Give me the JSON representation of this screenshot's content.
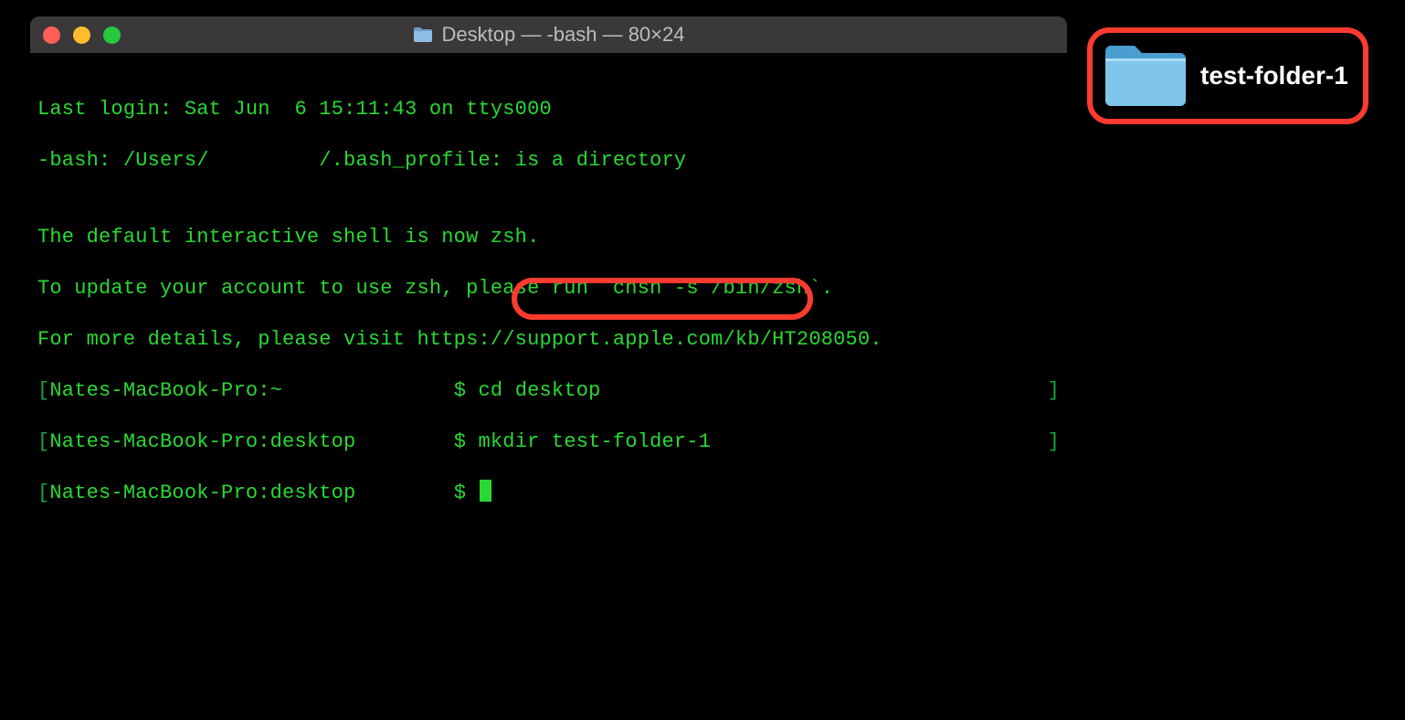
{
  "window": {
    "title": "Desktop — -bash — 80×24"
  },
  "terminal": {
    "lines": {
      "l1": "Last login: Sat Jun  6 15:11:43 on ttys000",
      "l2": "-bash: /Users/         /.bash_profile: is a directory",
      "l3": "",
      "l4": "The default interactive shell is now zsh.",
      "l5": "To update your account to use zsh, please run `chsh -s /bin/zsh`.",
      "l6": "For more details, please visit https://support.apple.com/kb/HT208050."
    },
    "prompts": {
      "p1": {
        "lb": "[",
        "host": "Nates-MacBook-Pro:~              ",
        "sym": "$ ",
        "cmd": "cd desktop",
        "rb": "]"
      },
      "p2": {
        "lb": "[",
        "host": "Nates-MacBook-Pro:desktop        ",
        "sym": "$ ",
        "cmd": "mkdir test-folder-1",
        "rb": "]"
      },
      "p3": {
        "lb": "[",
        "host": "Nates-MacBook-Pro:desktop        ",
        "sym": "$ "
      }
    }
  },
  "desktop": {
    "folder_name": "test-folder-1"
  },
  "colors": {
    "highlight": "#ff3b30",
    "term_fg": "#29d933",
    "folder": "#67b7e1"
  }
}
